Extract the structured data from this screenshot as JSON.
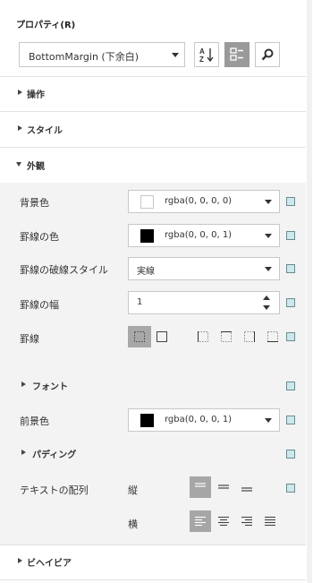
{
  "panel": {
    "title": "プロパティ(R)"
  },
  "selector": {
    "value": "BottomMargin (下余白)"
  },
  "toolbar": {
    "sort_icon": "sort-az-icon",
    "category_icon": "category-view-icon",
    "search_icon": "search-icon"
  },
  "sections": {
    "operations": "操作",
    "style": "スタイル",
    "appearance": "外観",
    "behavior": "ビヘイビア"
  },
  "appearance": {
    "background_color": {
      "label": "背景色",
      "value": "rgba(0, 0, 0, 0)",
      "swatch": "#ffffff"
    },
    "border_color": {
      "label": "罫線の色",
      "value": "rgba(0, 0, 0, 1)",
      "swatch": "#000000"
    },
    "border_dash_style": {
      "label": "罫線の破線スタイル",
      "value": "実線"
    },
    "border_width": {
      "label": "罫線の幅",
      "value": "1"
    },
    "borders": {
      "label": "罫線"
    },
    "font": {
      "label": "フォント"
    },
    "foreground_color": {
      "label": "前景色",
      "value": "rgba(0, 0, 0, 1)",
      "swatch": "#000000"
    },
    "padding": {
      "label": "パディング"
    },
    "text_alignment": {
      "label": "テキストの配列",
      "vertical_label": "縦",
      "horizontal_label": "横"
    }
  },
  "colors": {
    "accent_square": "#cde7ea",
    "active_button": "#a6a6a6",
    "grey_panel": "#f3f3f3"
  }
}
